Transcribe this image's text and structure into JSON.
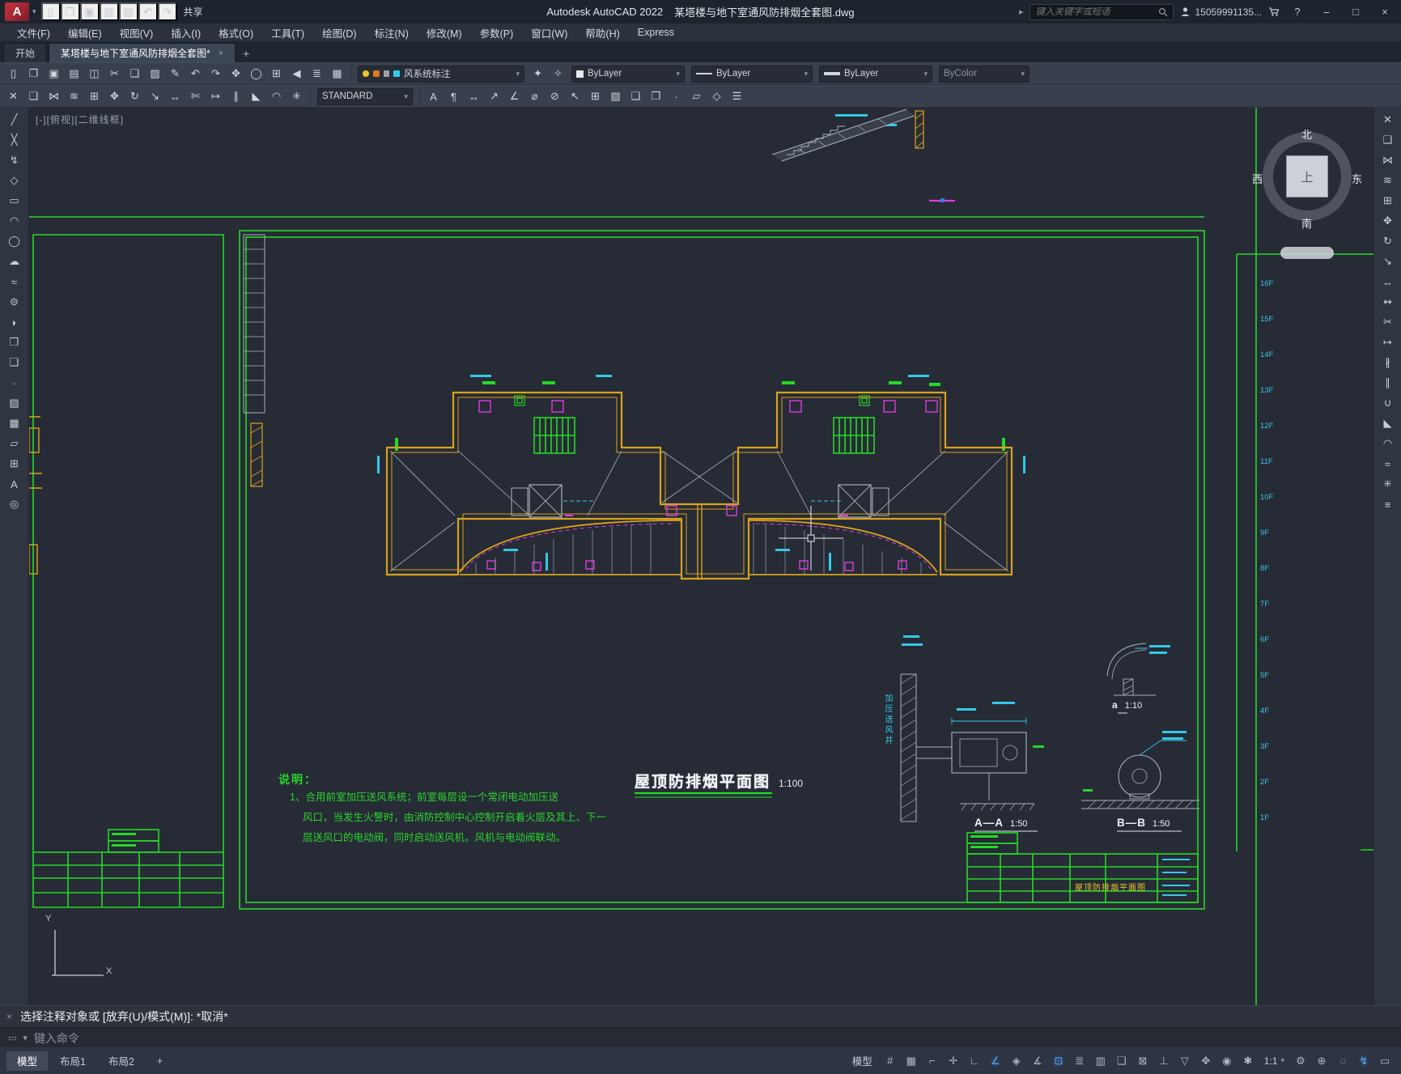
{
  "titlebar": {
    "logo": "A",
    "quick_icons": [
      {
        "n": "new-file-icon",
        "g": "▯"
      },
      {
        "n": "open-folder-icon",
        "g": "❐"
      },
      {
        "n": "save-icon",
        "g": "▣"
      },
      {
        "n": "save-as-icon",
        "g": "▥"
      },
      {
        "n": "plot-icon",
        "g": "▤"
      },
      {
        "n": "undo-icon",
        "g": "↶"
      },
      {
        "n": "redo-icon",
        "g": "↷"
      }
    ],
    "share": "共享",
    "app_title": "Autodesk AutoCAD 2022",
    "doc_title": "某塔楼与地下室通风防排烟全套图.dwg",
    "expand_glyph": "▸",
    "search_placeholder": "键入关键字或短语",
    "account": "15059991135...",
    "help": "?",
    "window": {
      "min": "–",
      "max": "□",
      "close": "×"
    }
  },
  "menubar": [
    "文件(F)",
    "编辑(E)",
    "视图(V)",
    "插入(I)",
    "格式(O)",
    "工具(T)",
    "绘图(D)",
    "标注(N)",
    "修改(M)",
    "参数(P)",
    "窗口(W)",
    "帮助(H)",
    "Express"
  ],
  "filetabs": {
    "start": "开始",
    "active": "某塔楼与地下室通风防排烟全套图*",
    "close": "×",
    "add": "+"
  },
  "toolbar1": {
    "icons": [
      {
        "n": "qnew-icon",
        "g": "▯"
      },
      {
        "n": "open-icon",
        "g": "❐"
      },
      {
        "n": "save-icon",
        "g": "▣"
      },
      {
        "n": "plot-icon",
        "g": "▤"
      },
      {
        "n": "plot-preview-icon",
        "g": "◫"
      },
      {
        "n": "cut-icon",
        "g": "✂"
      },
      {
        "n": "copy-clip-icon",
        "g": "❏"
      },
      {
        "n": "paste-icon",
        "g": "▨"
      },
      {
        "n": "match-properties-icon",
        "g": "✎"
      },
      {
        "n": "undo-icon",
        "g": "↶"
      },
      {
        "n": "redo-icon",
        "g": "↷"
      },
      {
        "n": "pan-icon",
        "g": "✥"
      },
      {
        "n": "zoom-realtime-icon",
        "g": "◯"
      },
      {
        "n": "zoom-window-icon",
        "g": "⊞"
      },
      {
        "n": "zoom-previous-icon",
        "g": "◀"
      },
      {
        "n": "layer-properties-icon",
        "g": "≣"
      },
      {
        "n": "layer-states-icon",
        "g": "▦"
      }
    ],
    "layer_combo": "风系统标注",
    "after_icons": [
      {
        "n": "make-layer-current-icon",
        "g": "✦"
      },
      {
        "n": "layer-previous-icon",
        "g": "✧"
      }
    ],
    "color_combo": "ByLayer",
    "linetype_combo": "ByLayer",
    "lineweight_combo": "ByLayer",
    "plotstyle_combo": "ByColor"
  },
  "toolbar2": {
    "icons_left": [
      {
        "n": "erase-icon",
        "g": "✕"
      },
      {
        "n": "copy-icon",
        "g": "❏"
      },
      {
        "n": "mirror-icon",
        "g": "⋈"
      },
      {
        "n": "offset-icon",
        "g": "≋"
      },
      {
        "n": "array-icon",
        "g": "⊞"
      },
      {
        "n": "move-icon",
        "g": "✥"
      },
      {
        "n": "rotate-icon",
        "g": "↻"
      },
      {
        "n": "scale-icon",
        "g": "↘"
      },
      {
        "n": "stretch-icon",
        "g": "↔"
      },
      {
        "n": "trim-icon",
        "g": "✄"
      },
      {
        "n": "extend-icon",
        "g": "↦"
      },
      {
        "n": "break-icon",
        "g": "∥"
      },
      {
        "n": "chamfer-icon",
        "g": "◣"
      },
      {
        "n": "fillet-icon",
        "g": "◠"
      },
      {
        "n": "explode-icon",
        "g": "✳"
      }
    ],
    "style_combo": "STANDARD",
    "icons_right": [
      {
        "n": "text-icon",
        "g": "A"
      },
      {
        "n": "mtext-icon",
        "g": "¶"
      },
      {
        "n": "dim-linear-icon",
        "g": "↔"
      },
      {
        "n": "dim-aligned-icon",
        "g": "↗"
      },
      {
        "n": "dim-angular-icon",
        "g": "∠"
      },
      {
        "n": "dim-radius-icon",
        "g": "⌀"
      },
      {
        "n": "dim-diameter-icon",
        "g": "⊘"
      },
      {
        "n": "leader-icon",
        "g": "↖"
      },
      {
        "n": "table-icon",
        "g": "⊞"
      },
      {
        "n": "hatch-icon",
        "g": "▨"
      },
      {
        "n": "make-block-icon",
        "g": "❑"
      },
      {
        "n": "insert-block-icon",
        "g": "❒"
      },
      {
        "n": "point-icon",
        "g": "∙"
      },
      {
        "n": "region-icon",
        "g": "▱"
      },
      {
        "n": "boundary-icon",
        "g": "◇"
      },
      {
        "n": "properties-icon",
        "g": "☰"
      }
    ]
  },
  "draw_tools": [
    {
      "n": "line-tool-icon",
      "g": "╱"
    },
    {
      "n": "construction-line-icon",
      "g": "╳"
    },
    {
      "n": "polyline-icon",
      "g": "↯"
    },
    {
      "n": "polygon-icon",
      "g": "◇"
    },
    {
      "n": "rectangle-icon",
      "g": "▭"
    },
    {
      "n": "arc-icon",
      "g": "◠"
    },
    {
      "n": "circle-icon",
      "g": "◯"
    },
    {
      "n": "revision-cloud-icon",
      "g": "☁"
    },
    {
      "n": "spline-icon",
      "g": "≈"
    },
    {
      "n": "ellipse-icon",
      "g": "⊜"
    },
    {
      "n": "ellipse-arc-icon",
      "g": "◗"
    },
    {
      "n": "insert-block-icon",
      "g": "❒"
    },
    {
      "n": "make-block-icon",
      "g": "❑"
    },
    {
      "n": "point-icon",
      "g": "∙"
    },
    {
      "n": "hatch-icon",
      "g": "▨"
    },
    {
      "n": "gradient-icon",
      "g": "▩"
    },
    {
      "n": "region-icon",
      "g": "▱"
    },
    {
      "n": "table-icon",
      "g": "⊞"
    },
    {
      "n": "multiline-text-icon",
      "g": "A"
    },
    {
      "n": "point-style-icon",
      "g": "◎"
    }
  ],
  "modify_tools": [
    {
      "n": "erase-icon",
      "g": "✕"
    },
    {
      "n": "copy-icon",
      "g": "❏"
    },
    {
      "n": "mirror-icon",
      "g": "⋈"
    },
    {
      "n": "offset-icon",
      "g": "≋"
    },
    {
      "n": "array-icon",
      "g": "⊞"
    },
    {
      "n": "move-icon",
      "g": "✥"
    },
    {
      "n": "rotate-icon",
      "g": "↻"
    },
    {
      "n": "scale-icon",
      "g": "↘"
    },
    {
      "n": "stretch-icon",
      "g": "↔"
    },
    {
      "n": "lengthen-icon",
      "g": "↭"
    },
    {
      "n": "trim-icon",
      "g": "✂"
    },
    {
      "n": "extend-icon",
      "g": "↦"
    },
    {
      "n": "break-at-point-icon",
      "g": "∦"
    },
    {
      "n": "break-icon",
      "g": "∥"
    },
    {
      "n": "join-icon",
      "g": "∪"
    },
    {
      "n": "chamfer-icon",
      "g": "◣"
    },
    {
      "n": "fillet-icon",
      "g": "◠"
    },
    {
      "n": "blend-icon",
      "g": "≈"
    },
    {
      "n": "explode-icon",
      "g": "✳"
    },
    {
      "n": "align-icon",
      "g": "≡"
    }
  ],
  "canvas": {
    "viewport_control": "[-][俯视][二维线框]",
    "compass": {
      "n": "北",
      "s": "南",
      "e": "东",
      "w": "西",
      "center": "上"
    },
    "floors": [
      "16F",
      "15F",
      "14F",
      "13F",
      "12F",
      "11F",
      "10F",
      "9F",
      "8F",
      "7F",
      "6F",
      "5F",
      "4F",
      "3F",
      "2F",
      "1F"
    ],
    "plan_title": {
      "text": "屋顶防排烟平面图",
      "scale": "1:100"
    },
    "notes": {
      "title": "说明：",
      "lines": [
        "1、合用前室加压送风系统；前室每层设一个常闭电动加压送",
        "风口，当发生火警时，由消防控制中心控制开启着火层及其上、下一",
        "层送风口的电动阀，同时启动送风机，风机与电动阀联动。"
      ]
    },
    "details": {
      "aa": {
        "label": "A—A",
        "scale": "1:50",
        "shaft": "加压送风井"
      },
      "bb": {
        "label": "B—B",
        "scale": "1:50"
      },
      "a": {
        "label": "a",
        "scale": "1:10"
      }
    },
    "titleblock_right_title": "屋顶防排烟平面图",
    "ucs": {
      "x": "X",
      "y": "Y"
    }
  },
  "command": {
    "close": "×",
    "history": "选择注释对象或 [放弃(U)/模式(M)]: *取消*",
    "prompt_icon": "▭",
    "prompt_caret": "▾",
    "prompt": "键入命令"
  },
  "statusbar": {
    "tabs": [
      {
        "label": "模型",
        "active": true
      },
      {
        "label": "布局1",
        "active": false
      },
      {
        "label": "布局2",
        "active": false
      },
      {
        "label": "+",
        "active": false
      }
    ],
    "model_toggle": "模型",
    "icons_a": [
      {
        "n": "grid-icon",
        "g": "#",
        "active": false
      },
      {
        "n": "snap-mode-icon",
        "g": "▦",
        "active": false
      },
      {
        "n": "infer-constraints-icon",
        "g": "⌐",
        "active": false
      },
      {
        "n": "dynamic-input-icon",
        "g": "✛",
        "active": false
      },
      {
        "n": "ortho-mode-icon",
        "g": "∟",
        "active": false
      },
      {
        "n": "polar-tracking-icon",
        "g": "∠",
        "active": true
      },
      {
        "n": "isometric-drafting-icon",
        "g": "◈",
        "active": false
      },
      {
        "n": "object-snap-tracking-icon",
        "g": "∡",
        "active": false
      },
      {
        "n": "object-snap-icon",
        "g": "⊡",
        "active": true
      },
      {
        "n": "lineweight-icon",
        "g": "≣",
        "active": false
      },
      {
        "n": "transparency-icon",
        "g": "▥",
        "active": false
      },
      {
        "n": "selection-cycling-icon",
        "g": "❏",
        "active": false
      },
      {
        "n": "3d-object-snap-icon",
        "g": "⊠",
        "active": false
      },
      {
        "n": "dynamic-ucs-icon",
        "g": "⊥",
        "active": false
      },
      {
        "n": "selection-filtering-icon",
        "g": "▽",
        "active": false
      },
      {
        "n": "gizmo-icon",
        "g": "✥",
        "active": false
      },
      {
        "n": "annotation-visibility-icon",
        "g": "◉",
        "active": false
      },
      {
        "n": "autoscale-icon",
        "g": "✱",
        "active": false
      }
    ],
    "scale": "1:1",
    "icons_b": [
      {
        "n": "workspace-icon",
        "g": "⚙",
        "active": false
      },
      {
        "n": "annotation-monitor-icon",
        "g": "⊕",
        "active": false
      },
      {
        "n": "isolate-objects-icon",
        "g": "◌",
        "active": false
      },
      {
        "n": "graphics-performance-icon",
        "g": "↯",
        "active": true
      },
      {
        "n": "clean-screen-icon",
        "g": "▭",
        "active": false
      }
    ]
  }
}
